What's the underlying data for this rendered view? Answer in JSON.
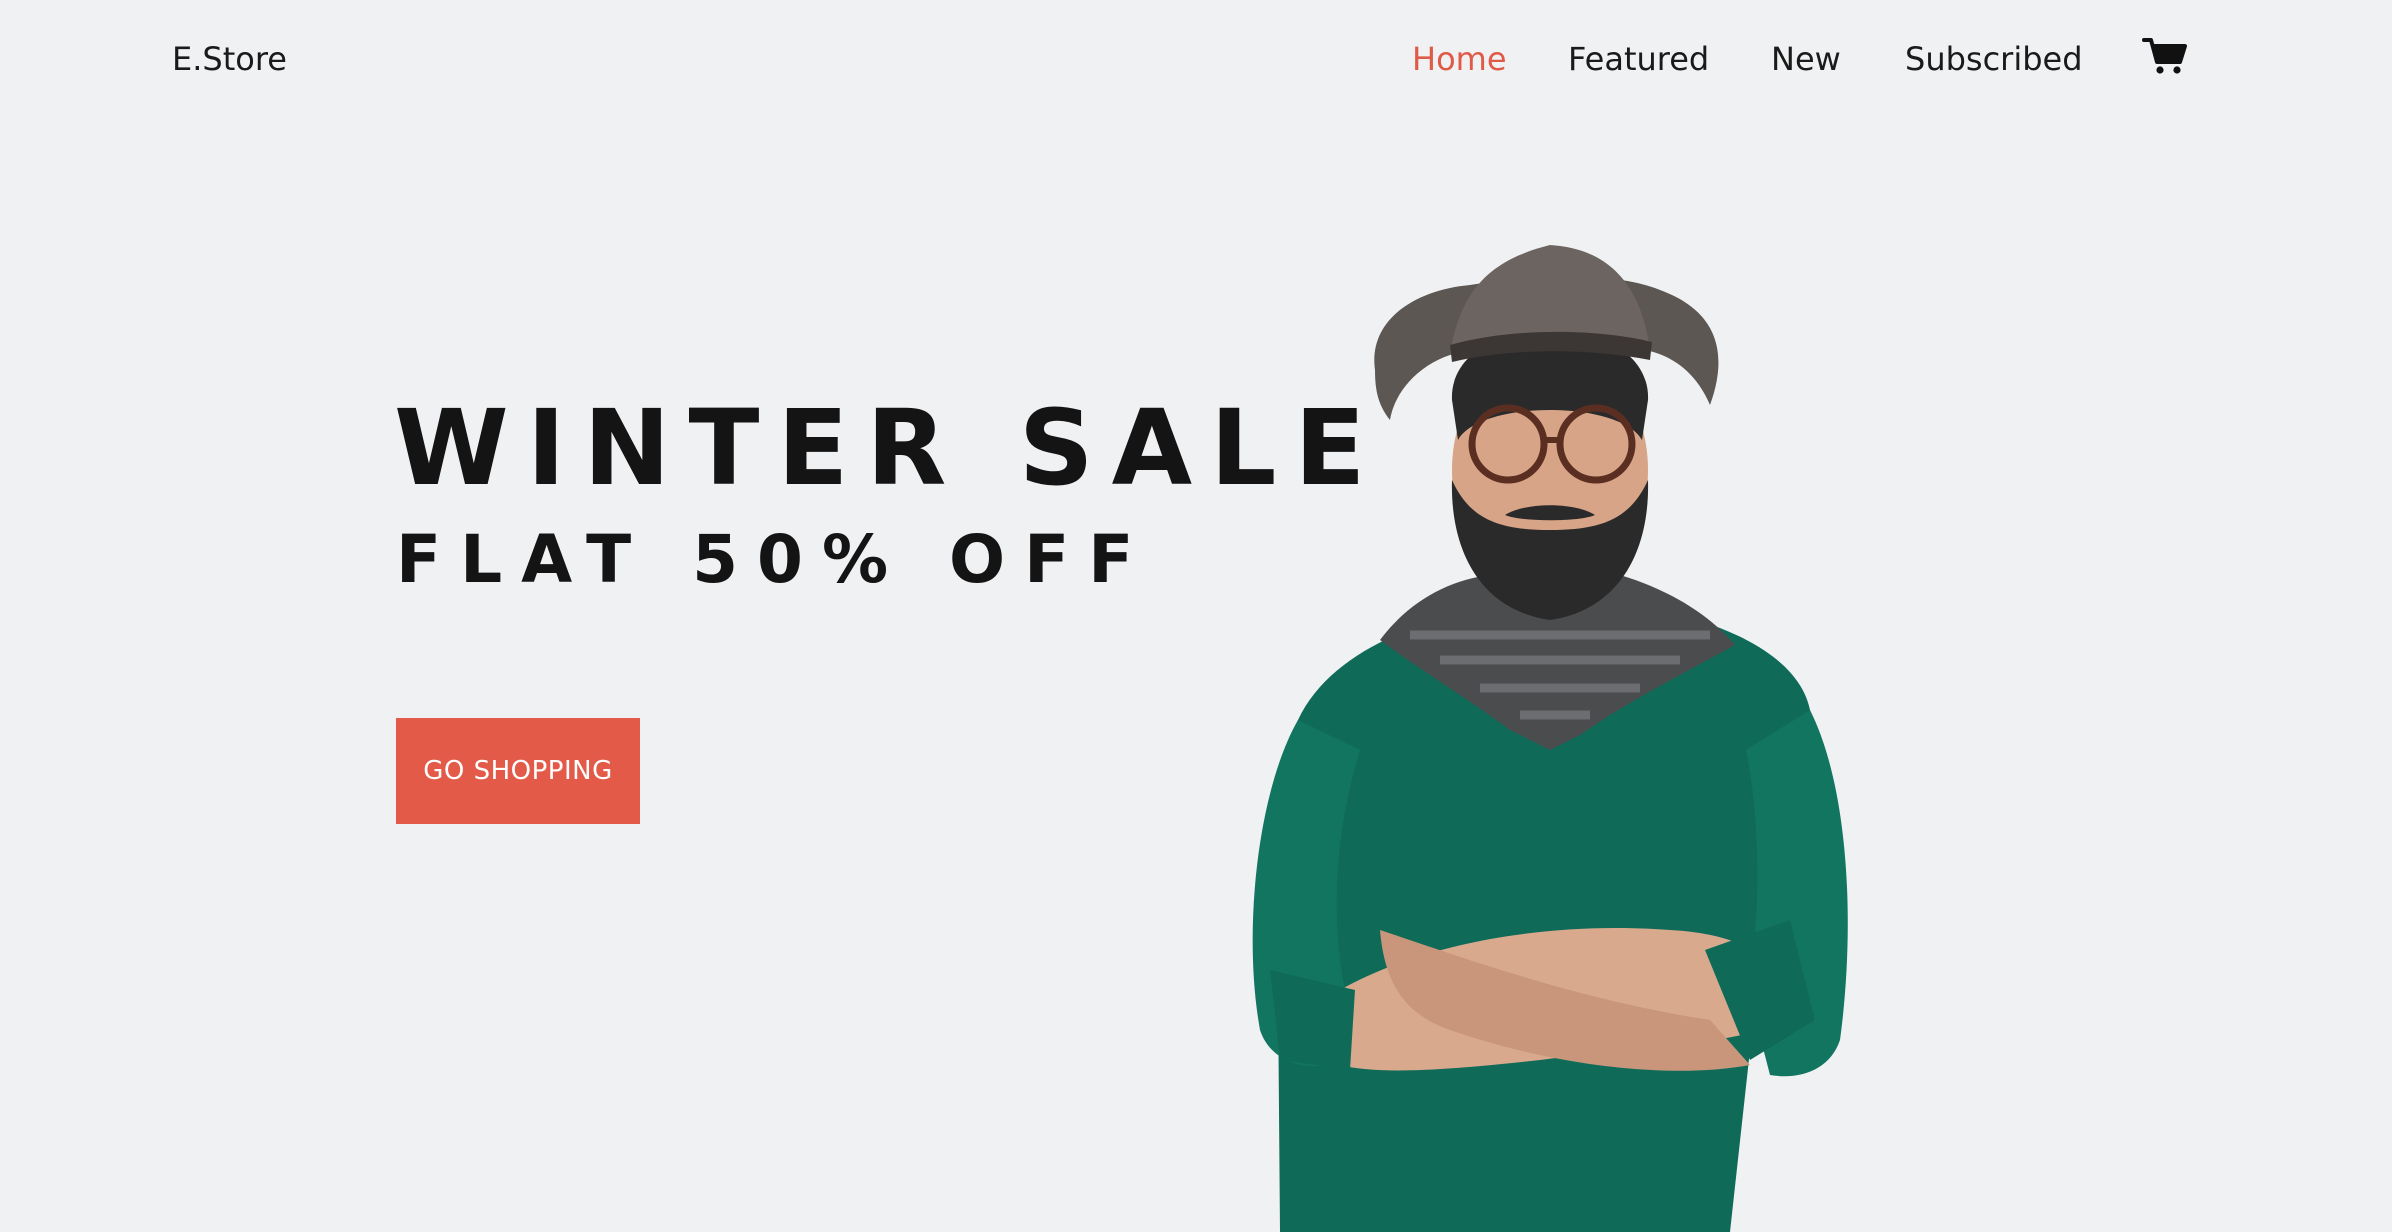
{
  "header": {
    "brand": "E.Store",
    "nav": [
      {
        "label": "Home",
        "active": true
      },
      {
        "label": "Featured",
        "active": false
      },
      {
        "label": "New",
        "active": false
      },
      {
        "label": "Subscribed",
        "active": false
      }
    ],
    "cart_icon": "shopping-cart-icon"
  },
  "hero": {
    "title": "WINTER SALE",
    "subtitle": "FLAT 50% OFF",
    "cta_label": "GO SHOPPING",
    "image": "man-in-hat-and-green-sweater-photo"
  },
  "colors": {
    "background": "#f0f1f3",
    "accent": "#e35a48",
    "text": "#141414",
    "active_nav": "#e05a47"
  }
}
